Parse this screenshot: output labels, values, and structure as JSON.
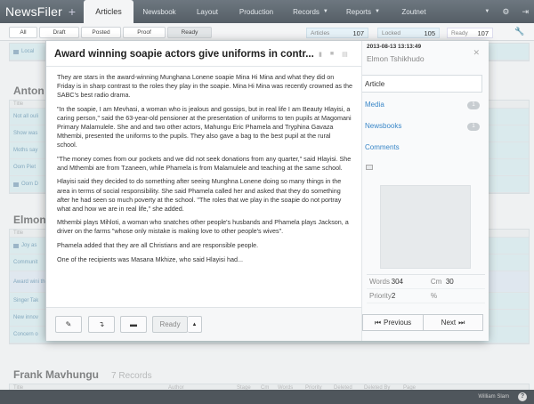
{
  "app": {
    "brand": "NewsFiler",
    "add_symbol": "+"
  },
  "nav": {
    "tabs": [
      {
        "label": "Articles",
        "active": true
      },
      {
        "label": "Newsbook"
      },
      {
        "label": "Layout"
      },
      {
        "label": "Production"
      },
      {
        "label": "Records"
      },
      {
        "label": "Reports"
      },
      {
        "label": "Zoutnet"
      }
    ],
    "icons": [
      "chevron-down-icon",
      "settings-icon",
      "logout-icon"
    ]
  },
  "filters": {
    "buttons": [
      "All",
      "Draft",
      "Posted",
      "Proof",
      "Ready"
    ],
    "selected": "Ready",
    "stats": [
      {
        "label": "Articles",
        "value": "107"
      },
      {
        "label": "Locked",
        "value": "105"
      },
      {
        "label": "Ready",
        "value": "107"
      }
    ]
  },
  "background": {
    "groups": [
      {
        "name": "Anton",
        "count": ""
      },
      {
        "name": "Elmon",
        "count": ""
      },
      {
        "name": "Frank Mavhungu",
        "count": "7 Records"
      }
    ],
    "top_rows": [
      "Local"
    ],
    "anton_rows": [
      "Title",
      "Not all ouli",
      "Show was",
      "Moths say",
      "Oom Piet",
      "Oom D"
    ],
    "elmon_rows": [
      "Title",
      "Joy as",
      "Communit",
      "Award wini the roles in",
      "Singer Tak",
      "New innov",
      "Concern o"
    ],
    "frank_header": [
      "Title",
      "Author",
      "Stage",
      "Cm",
      "Words",
      "Priority",
      "Deleted",
      "Deleted By",
      "Page"
    ],
    "status_user": "William Slam"
  },
  "article": {
    "title": "Award winning soapie actors give uniforms in contr...",
    "paragraphs": [
      "They are stars in the award-winning Munghana Lonene soapie Mina Hi Mina and what they did on Friday is in sharp contrast to the roles they play in the soapie. Mina Hi Mina was recently crowned as the SABC's best radio drama.",
      "\"In the soapie, I am Mevhasi, a woman who is jealous and gossips, but in real life I am Beauty Hlayisi, a caring person,\" said the 63-year-old pensioner at the presentation of uniforms to ten pupils at Magomani Primary Malamulele. She and and two other actors, Mahungu Eric Phamela and Tryphina Gavaza Mthembi, presented the uniforms to the pupils. They also gave a bag to the best pupil at the rural school.",
      "\"The money comes from our pockets and we did not seek donations from any quarter,\" said Hlayisi. She and Mthembi are from Tzaneen, while Phamela is from Malamulele and teaching at the same school.",
      "Hlayisi said they decided to do something after seeing Munghna Lonene doing so many things in the area in terms of social responsibility. She said Phamela called her and asked that they do something after he had seen so much poverty at the school. \"The roles that we play in the soapie do not portray what and how we are in real life,\" she added.",
      "Mthembi plays Mihloti, a woman who snatches other people's husbands and Phamela plays Jackson, a driver on the farms \"whose only mistake is making love to other people's wives\".",
      "Phamela added that they are all Christians and are responsible people.",
      "One of the recipients was Masana Mkhize, who said Hlayisi had..."
    ],
    "footer": {
      "status_label": "Ready"
    }
  },
  "sidebar": {
    "date": "2013-08-13 13:13:49",
    "author": "Elmon Tshikhudo",
    "tab_article": "Article",
    "links": [
      {
        "label": "Media",
        "badge": "1"
      },
      {
        "label": "Newsbooks",
        "badge": "1"
      },
      {
        "label": "Comments",
        "badge": ""
      }
    ],
    "stats": {
      "words_label": "Words",
      "words": "304",
      "cm_label": "Cm",
      "cm": "30",
      "priority_label": "Priority",
      "priority": "2",
      "pct_label": "%",
      "pct": ""
    },
    "prev_label": "Previous",
    "next_label": "Next"
  },
  "colors": {
    "accent": "#3a87c8",
    "topbar": "#5f6870",
    "highlight_row": "#dff5f7"
  }
}
